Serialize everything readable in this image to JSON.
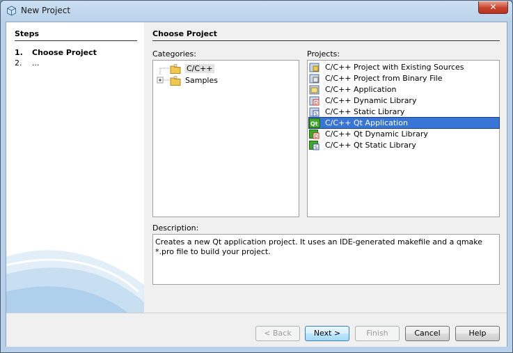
{
  "window": {
    "title": "New Project"
  },
  "steps": {
    "title": "Steps",
    "items": [
      {
        "num": "1.",
        "label": "Choose Project"
      },
      {
        "num": "2.",
        "label": "..."
      }
    ]
  },
  "main": {
    "title": "Choose Project",
    "categories_label": "Categories:",
    "projects_label": "Projects:",
    "description_label": "Description:"
  },
  "categories": [
    {
      "label": "C/C++",
      "selected": true
    },
    {
      "label": "Samples",
      "expandable": true
    }
  ],
  "projects": [
    {
      "label": "C/C++ Project with Existing Sources",
      "icon": "existing-sources-icon"
    },
    {
      "label": "C/C++ Project from Binary File",
      "icon": "binary-file-icon"
    },
    {
      "label": "C/C++ Application",
      "icon": "application-icon"
    },
    {
      "label": "C/C++ Dynamic Library",
      "icon": "dynamic-library-icon"
    },
    {
      "label": "C/C++ Static Library",
      "icon": "static-library-icon"
    },
    {
      "label": "C/C++ Qt Application",
      "icon": "qt-application-icon",
      "selected": true
    },
    {
      "label": "C/C++ Qt Dynamic Library",
      "icon": "qt-dynamic-library-icon"
    },
    {
      "label": "C/C++ Qt Static Library",
      "icon": "qt-static-library-icon"
    }
  ],
  "description": "Creates a new Qt application project. It uses an IDE-generated makefile and a qmake *.pro file to build your project.",
  "buttons": {
    "back": "< Back",
    "next": "Next >",
    "finish": "Finish",
    "cancel": "Cancel",
    "help": "Help"
  },
  "colors": {
    "selection": "#3875d7",
    "qt_green": "#41a62a"
  }
}
